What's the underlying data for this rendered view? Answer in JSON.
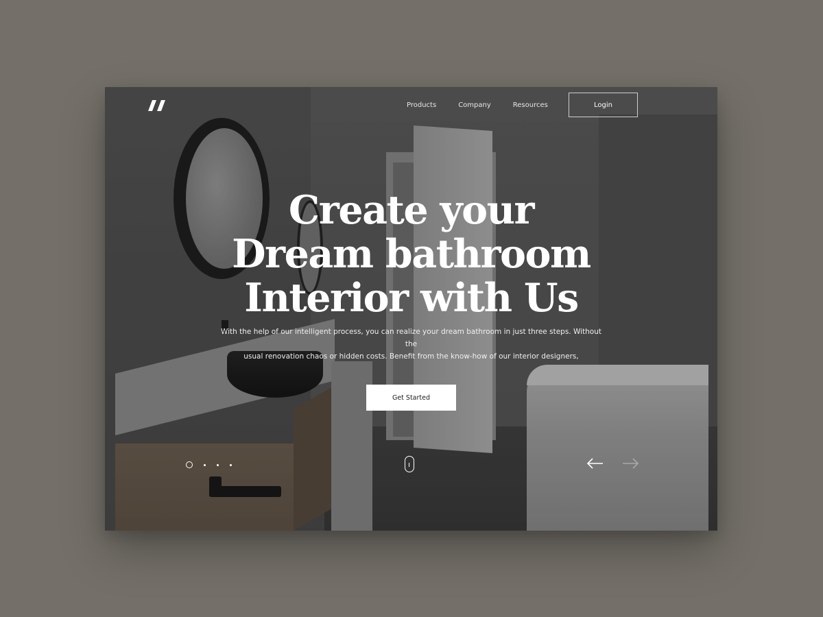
{
  "nav": {
    "items": [
      "Products",
      "Company",
      "Resources"
    ],
    "login_label": "Login"
  },
  "hero": {
    "title_lines": [
      "Create your",
      "Dream bathroom",
      "Interior with Us"
    ],
    "description_line1": "With the help of our intelligent process, you can realize your dream bathroom in just three steps. Without the",
    "description_line2": "usual renovation chaos or hidden costs. Benefit from the know-how of our interior designers,",
    "cta_label": "Get Started"
  },
  "slider": {
    "slide_count": 4,
    "active_slide": 1
  },
  "icons": {
    "logo": "quote-logo-icon",
    "prev": "arrow-left-icon",
    "next": "arrow-right-icon",
    "scroll": "scroll-mouse-icon"
  },
  "colors": {
    "page_background": "#747069",
    "text": "#ffffff",
    "cta_background": "#ffffff",
    "cta_text": "#1a1a1a"
  }
}
